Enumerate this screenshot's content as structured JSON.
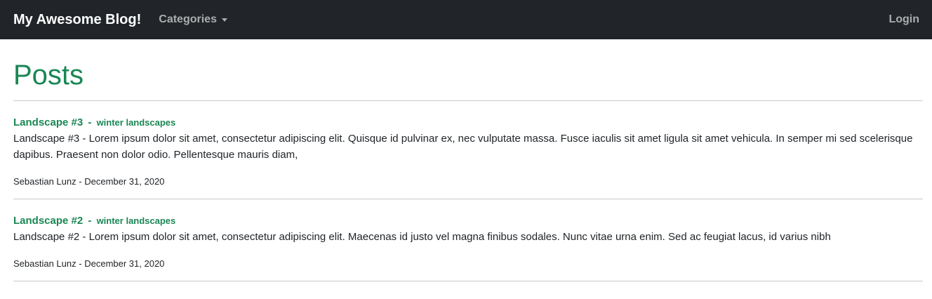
{
  "navbar": {
    "brand": "My Awesome Blog!",
    "categories_label": "Categories",
    "login_label": "Login"
  },
  "page": {
    "title": "Posts"
  },
  "posts": [
    {
      "title": "Landscape #3",
      "separator": "-",
      "category": "winter landscapes",
      "body": "Landscape #3 - Lorem ipsum dolor sit amet, consectetur adipiscing elit. Quisque id pulvinar ex, nec vulputate massa. Fusce iaculis sit amet ligula sit amet vehicula. In semper mi sed scelerisque dapibus. Praesent non dolor odio. Pellentesque mauris diam,",
      "author": "Sebastian Lunz",
      "meta_separator": "-",
      "date": "December 31, 2020"
    },
    {
      "title": "Landscape #2",
      "separator": "-",
      "category": "winter landscapes",
      "body": "Landscape #2 - Lorem ipsum dolor sit amet, consectetur adipiscing elit. Maecenas id justo vel magna finibus sodales. Nunc vitae urna enim. Sed ac feugiat lacus, id varius nibh",
      "author": "Sebastian Lunz",
      "meta_separator": "-",
      "date": "December 31, 2020"
    }
  ],
  "colors": {
    "navbar_bg": "#212529",
    "accent": "#198754"
  }
}
